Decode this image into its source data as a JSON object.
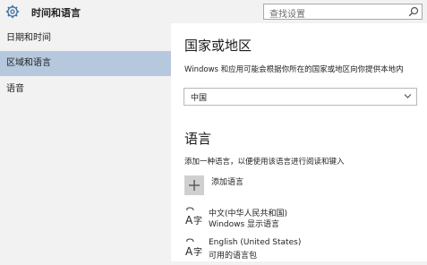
{
  "header": {
    "title": "时间和语言",
    "search_placeholder": "查找设置"
  },
  "sidebar": {
    "items": [
      {
        "label": "日期和时间",
        "selected": false
      },
      {
        "label": "区域和语言",
        "selected": true
      },
      {
        "label": "语音",
        "selected": false
      }
    ]
  },
  "region": {
    "title": "国家或地区",
    "description": "Windows 和应用可能会根据你所在的国家或地区向你提供本地内",
    "country_value": "中国"
  },
  "language": {
    "title": "语言",
    "description": "添加一种语言，以便使用该语言进行阅读和键入",
    "add_label": "添加语言",
    "items": [
      {
        "name": "中文(中华人民共和国)",
        "status": "Windows 显示语言"
      },
      {
        "name": "English (United States)",
        "status": "可用的语言包"
      }
    ]
  },
  "colors": {
    "selected_nav": "#b6c8de",
    "sidebar_bg": "#f2f2f2",
    "content_bg": "#ffffff"
  },
  "icons": {
    "settings": "gear-icon",
    "search": "search-icon",
    "add": "plus-icon",
    "language": "language-icon",
    "dropdown": "chevron-down-icon"
  }
}
